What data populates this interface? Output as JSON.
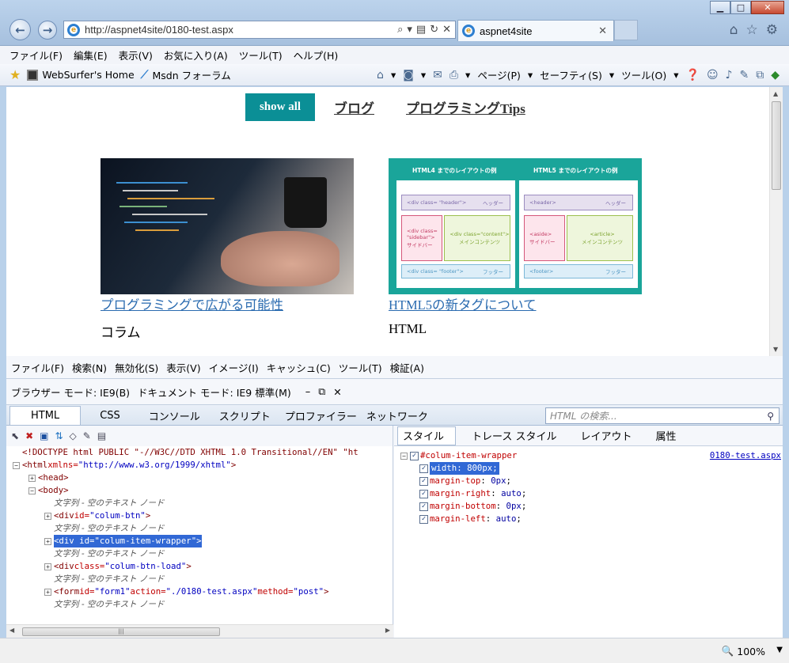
{
  "window": {
    "url": "http://aspnet4site/0180-test.aspx",
    "tab_title": "aspnet4site"
  },
  "menubar": [
    "ファイル(F)",
    "編集(E)",
    "表示(V)",
    "お気に入り(A)",
    "ツール(T)",
    "ヘルプ(H)"
  ],
  "favorites": {
    "item1": "WebSurfer's Home",
    "item2": "Msdn フォーラム"
  },
  "commandbar": {
    "page": "ページ(P)",
    "safety": "セーフティ(S)",
    "tools": "ツール(O)"
  },
  "page": {
    "nav": {
      "show_all": "show all",
      "blog": "ブログ",
      "tips": "プログラミングTips"
    },
    "cards": [
      {
        "title": "プログラミングで広がる可能性",
        "category": "コラム"
      },
      {
        "title": "HTML5の新タグについて",
        "category": "HTML"
      }
    ],
    "diagram": {
      "head_left": "HTML4 までのレイアウトの例",
      "head_right": "HTML5 までのレイアウトの例",
      "l_header": "<div class= \"header\">",
      "l_header_jp": "ヘッダー",
      "l_sidebar": "<div class= \"sidebar\">",
      "l_sidebar_jp": "サイドバー",
      "l_content": "<div class=\"content\">",
      "l_content_jp": "メインコンテンツ",
      "l_footer": "<div class= \"footer\">",
      "l_footer_jp": "フッター",
      "r_header": "<header>",
      "r_header_jp": "ヘッダー",
      "r_aside": "<aside>",
      "r_aside_jp": "サイドバー",
      "r_article": "<article>",
      "r_article_jp": "メインコンテンツ",
      "r_footer": "<footer>",
      "r_footer_jp": "フッター"
    }
  },
  "devtools": {
    "menu": [
      "ファイル(F)",
      "検索(N)",
      "無効化(S)",
      "表示(V)",
      "イメージ(I)",
      "キャッシュ(C)",
      "ツール(T)",
      "検証(A)"
    ],
    "browser_mode": "ブラウザー モード: IE9(B)",
    "document_mode": "ドキュメント モード: IE9 標準(M)",
    "tabs": [
      "HTML",
      "CSS",
      "コンソール",
      "スクリプト",
      "プロファイラー",
      "ネットワーク"
    ],
    "search_placeholder": "HTML の検索...",
    "style_tabs": [
      "スタイル",
      "トレース スタイル",
      "レイアウト",
      "属性"
    ],
    "tree": {
      "doctype": "<!DOCTYPE html PUBLIC \"-//W3C//DTD XHTML 1.0 Transitional//EN\" \"ht",
      "html_tag": "<html",
      "html_attr": " xmlns=",
      "html_val": "\"http://www.w3.org/1999/xhtml\"",
      "head": "<head>",
      "body": "<body>",
      "text_node": "文字列 - 空のテキスト ノード",
      "div1_tag": "<div",
      "div1_attr": " id=",
      "div1_val": "\"colum-btn\"",
      "div2": "<div id=\"colum-item-wrapper\">",
      "div3_tag": "<div",
      "div3_attr": " class=",
      "div3_val": "\"colum-btn-load\"",
      "form_tag": "<form",
      "form_a1": " id=",
      "form_v1": "\"form1\"",
      "form_a2": " action=",
      "form_v2": "\"./0180-test.aspx\"",
      "form_a3": " method=",
      "form_v3": "\"post\""
    },
    "rule": {
      "selector": "#colum-item-wrapper",
      "file": "0180-test.aspx",
      "props": [
        {
          "name": "width",
          "value": "800px"
        },
        {
          "name": "margin-top",
          "value": "0px"
        },
        {
          "name": "margin-right",
          "value": "auto"
        },
        {
          "name": "margin-bottom",
          "value": "0px"
        },
        {
          "name": "margin-left",
          "value": "auto"
        }
      ]
    }
  },
  "status": {
    "zoom": "100%"
  }
}
